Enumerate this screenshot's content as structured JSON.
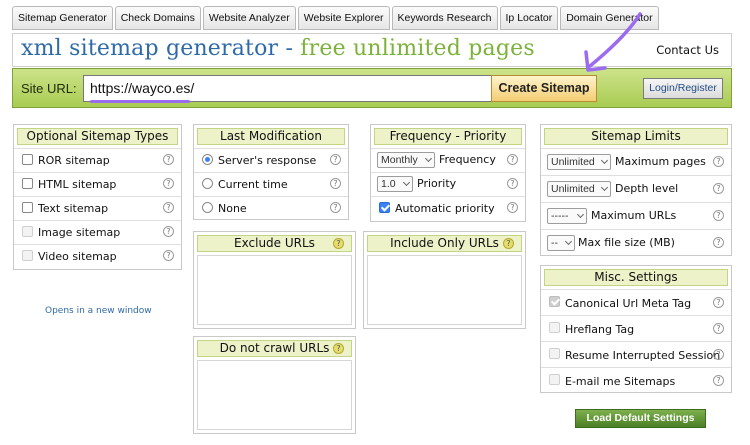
{
  "nav": {
    "tabs": [
      "Sitemap Generator",
      "Check Domains",
      "Website Analyzer",
      "Website Explorer",
      "Keywords Research",
      "Ip Locator",
      "Domain Generator"
    ]
  },
  "header": {
    "title_part1": "xml sitemap generator - ",
    "title_part2": "free unlimited pages",
    "contact": "Contact Us"
  },
  "url_bar": {
    "label": "Site URL:",
    "value": "https://wayco.es/",
    "create_button": "Create Sitemap",
    "login_button": "Login/Register"
  },
  "sitemap_types": {
    "title": "Optional Sitemap Types",
    "items": [
      {
        "label": "ROR sitemap",
        "checked": false,
        "enabled": true
      },
      {
        "label": "HTML sitemap",
        "checked": false,
        "enabled": true
      },
      {
        "label": "Text sitemap",
        "checked": false,
        "enabled": true
      },
      {
        "label": "Image sitemap",
        "checked": false,
        "enabled": false
      },
      {
        "label": "Video sitemap",
        "checked": false,
        "enabled": false
      }
    ],
    "note": "Opens in a new window"
  },
  "last_modification": {
    "title": "Last Modification",
    "options": [
      {
        "label": "Server's response",
        "selected": true
      },
      {
        "label": "Current time",
        "selected": false
      },
      {
        "label": "None",
        "selected": false
      }
    ]
  },
  "frequency_priority": {
    "title": "Frequency - Priority",
    "frequency_value": "Monthly",
    "frequency_label": "Frequency",
    "priority_value": "1.0",
    "priority_label": "Priority",
    "auto_priority_label": "Automatic priority",
    "auto_priority_checked": true
  },
  "sitemap_limits": {
    "title": "Sitemap Limits",
    "rows": [
      {
        "value": "Unlimited",
        "label": "Maximum pages"
      },
      {
        "value": "Unlimited",
        "label": "Depth level"
      },
      {
        "value": "-----",
        "label": "Maximum URLs"
      },
      {
        "value": "--",
        "label": "Max file size (MB)"
      }
    ]
  },
  "exclude_urls": {
    "title": "Exclude URLs"
  },
  "include_urls": {
    "title": "Include Only URLs"
  },
  "do_not_crawl": {
    "title": "Do not crawl URLs"
  },
  "misc_settings": {
    "title": "Misc. Settings",
    "items": [
      {
        "label": "Canonical Url Meta Tag",
        "checked": true,
        "enabled": false
      },
      {
        "label": "Hreflang Tag",
        "checked": false,
        "enabled": false
      },
      {
        "label": "Resume Interrupted Session",
        "checked": false,
        "enabled": false
      },
      {
        "label": "E-mail me Sitemaps",
        "checked": false,
        "enabled": false
      }
    ]
  },
  "load_defaults_button": "Load Default Settings",
  "colors": {
    "accent_green": "#a9cc53",
    "title_blue": "#2f6aa8",
    "title_green": "#7cb23a",
    "annotation_purple": "#9b6cf0"
  }
}
